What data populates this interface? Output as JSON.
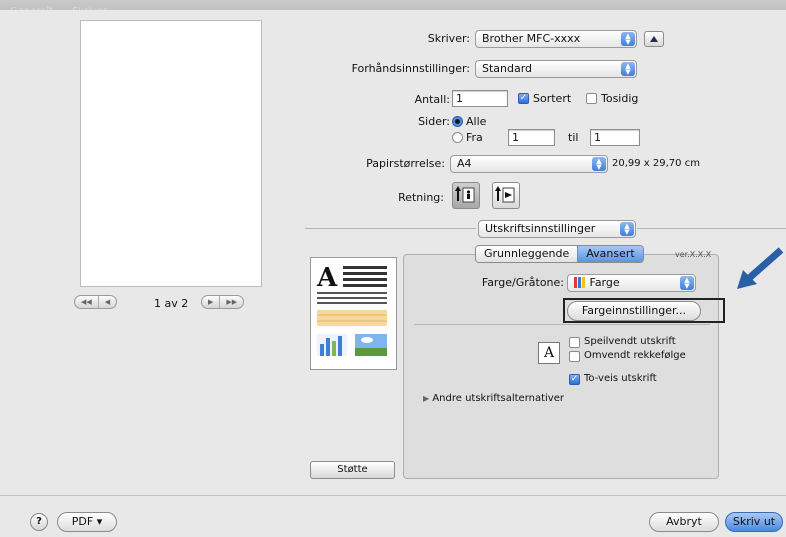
{
  "titlebar": {
    "ghost_left": "Generelt",
    "ghost_mid": "Skriver"
  },
  "printer": {
    "label": "Skriver:",
    "value": "Brother MFC-xxxx"
  },
  "presets": {
    "label": "Forhåndsinnstillinger:",
    "value": "Standard"
  },
  "copies": {
    "label": "Antall:",
    "value": "1",
    "collated_label": "Sortert",
    "collated": true,
    "duplex_label": "Tosidig",
    "duplex": false
  },
  "pages": {
    "label": "Sider:",
    "all_label": "Alle",
    "from_label": "Fra",
    "from_value": "1",
    "to_label": "til",
    "to_value": "1",
    "selected": "all"
  },
  "paper": {
    "label": "Papirstørrelse:",
    "value": "A4",
    "dimensions": "20,99 x 29,70 cm"
  },
  "orientation": {
    "label": "Retning:"
  },
  "section": {
    "value": "Utskriftsinnstillinger"
  },
  "tabs": [
    {
      "label": "Grunnleggende",
      "selected": false
    },
    {
      "label": "Avansert",
      "selected": true
    }
  ],
  "version": "ver.X.X.X",
  "advanced": {
    "color_label": "Farge/Gråtone:",
    "color_value": "Farge",
    "color_settings_button": "Fargeinnstillinger...",
    "mirror_label": "Speilvendt utskrift",
    "mirror": false,
    "reverse_label": "Omvendt rekkefølge",
    "reverse": false,
    "bidirectional_label": "To-veis utskrift",
    "bidirectional": true,
    "other_options_label": "Andre utskriftsalternativer"
  },
  "pager": {
    "text": "1 av 2"
  },
  "support_button": "Støtte",
  "footer": {
    "help": "?",
    "pdf": "PDF ▾",
    "cancel": "Avbryt",
    "print": "Skriv ut"
  },
  "colors": {
    "accent": "#3f7fdc",
    "arrow": "#2a5fa8",
    "dialog_bg": "#e8e8e8"
  }
}
